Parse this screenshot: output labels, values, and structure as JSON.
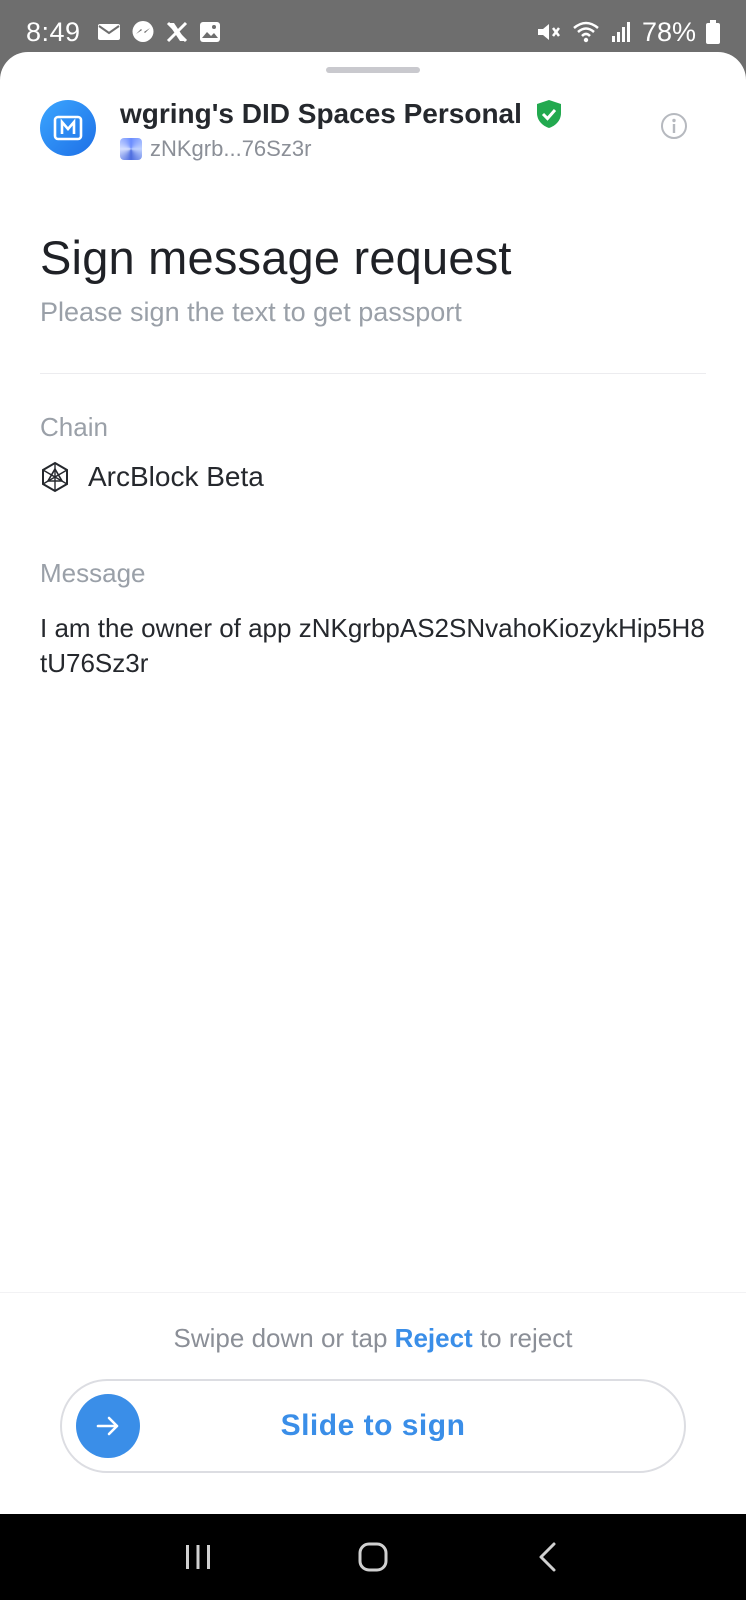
{
  "status_bar": {
    "time": "8:49",
    "notification_icons": [
      "mail-icon",
      "messenger-icon",
      "x-icon",
      "gallery-icon"
    ],
    "system_icons": [
      "mute-icon",
      "wifi-icon",
      "signal-icon",
      "battery-icon"
    ],
    "battery": "78%"
  },
  "app": {
    "name": "wgring's DID Spaces Personal",
    "did_short": "zNKgrb...76Sz3r",
    "verified": true
  },
  "request": {
    "title": "Sign message request",
    "subtitle": "Please sign the text to get passport"
  },
  "chain": {
    "label": "Chain",
    "value": "ArcBlock Beta"
  },
  "message": {
    "label": "Message",
    "text": "I am the owner of app zNKgrbpAS2SNvahoKiozykHip5H8tU76Sz3r"
  },
  "footer": {
    "hint_prefix": "Swipe down or tap",
    "reject_label": "Reject",
    "hint_suffix": "to reject",
    "slide_label": "Slide to sign"
  },
  "colors": {
    "accent": "#3a8ee8",
    "verified_badge": "#22a94f",
    "muted_text": "#9aa0a8"
  }
}
